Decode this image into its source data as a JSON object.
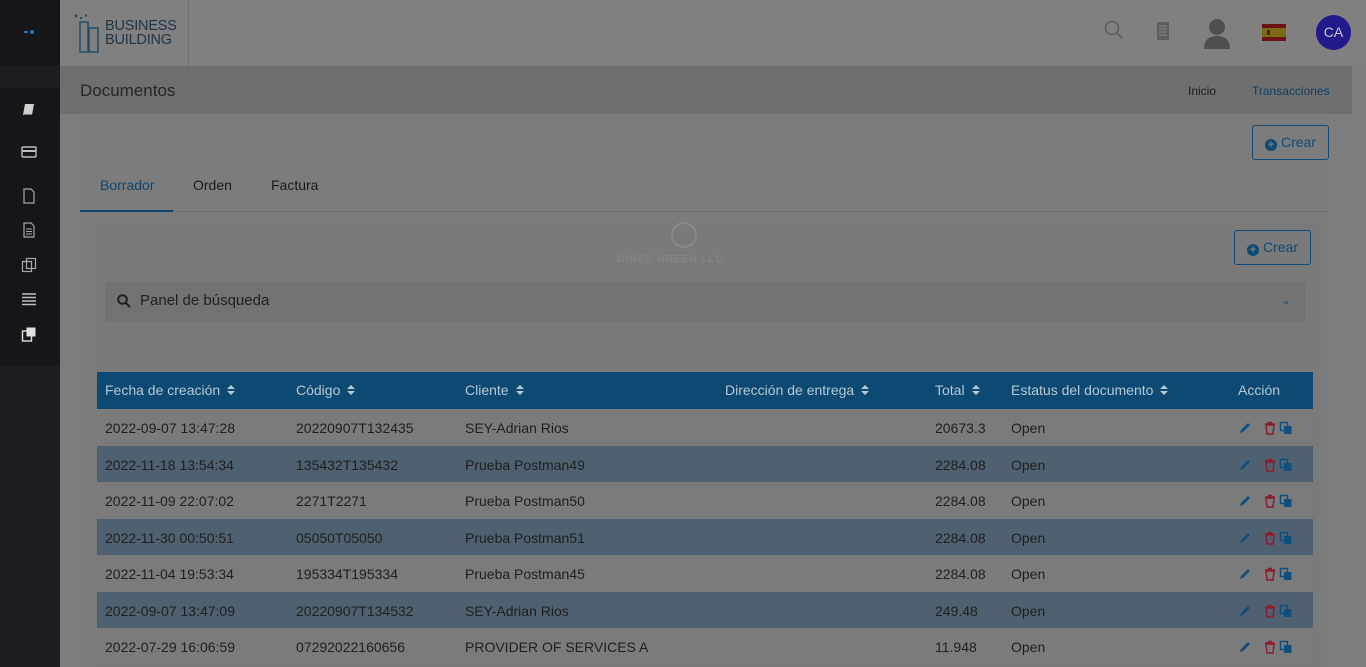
{
  "brand": {
    "line1": "BUSINESS",
    "line2": "BUILDING"
  },
  "topbar": {
    "user_initials": "CA",
    "icons": [
      "search-icon",
      "calculator-icon",
      "user-avatar-icon",
      "spain-flag-icon"
    ]
  },
  "sidebar": {
    "icons": [
      "book-icon",
      "credit-card-icon",
      "file-icon",
      "file-text-icon",
      "copy-icon",
      "list-icon",
      "clone-icon"
    ]
  },
  "page": {
    "title": "Documentos",
    "breadcrumb": {
      "home": "Inicio",
      "current": "Transacciones"
    }
  },
  "actions": {
    "create_label": "Crear"
  },
  "tabs": [
    {
      "label": "Borrador",
      "active": true
    },
    {
      "label": "Orden",
      "active": false
    },
    {
      "label": "Factura",
      "active": false
    }
  ],
  "inner": {
    "company": "DIGES GREEN LLC",
    "create_label": "Crear",
    "search_panel_label": "Panel de búsqueda"
  },
  "table": {
    "columns": [
      "Fecha de creación",
      "Código",
      "Cliente",
      "Dirección de entrega",
      "Total",
      "Estatus del documento",
      "Acción"
    ],
    "rows": [
      {
        "fecha": "2022-09-07 13:47:28",
        "codigo": "20220907T132435",
        "cliente": "SEY-Adrian Rios",
        "direccion": "",
        "total": "20673.3",
        "estatus": "Open"
      },
      {
        "fecha": "2022-11-18 13:54:34",
        "codigo": "135432T135432",
        "cliente": "Prueba Postman49",
        "direccion": "",
        "total": "2284.08",
        "estatus": "Open"
      },
      {
        "fecha": "2022-11-09 22:07:02",
        "codigo": "2271T2271",
        "cliente": "Prueba Postman50",
        "direccion": "",
        "total": "2284.08",
        "estatus": "Open"
      },
      {
        "fecha": "2022-11-30 00:50:51",
        "codigo": "05050T05050",
        "cliente": "Prueba Postman51",
        "direccion": "",
        "total": "2284.08",
        "estatus": "Open"
      },
      {
        "fecha": "2022-11-04 19:53:34",
        "codigo": "195334T195334",
        "cliente": "Prueba Postman45",
        "direccion": "",
        "total": "2284.08",
        "estatus": "Open"
      },
      {
        "fecha": "2022-09-07 13:47:09",
        "codigo": "20220907T134532",
        "cliente": "SEY-Adrian Rios",
        "direccion": "",
        "total": "249.48",
        "estatus": "Open"
      },
      {
        "fecha": "2022-07-29 16:06:59",
        "codigo": "07292022160656",
        "cliente": "PROVIDER OF SERVICES A",
        "direccion": "",
        "total": "11.948",
        "estatus": "Open"
      }
    ]
  },
  "colors": {
    "accent": "#0c4a73",
    "avatar": "#23198a",
    "delete": "#8c1d2d"
  }
}
